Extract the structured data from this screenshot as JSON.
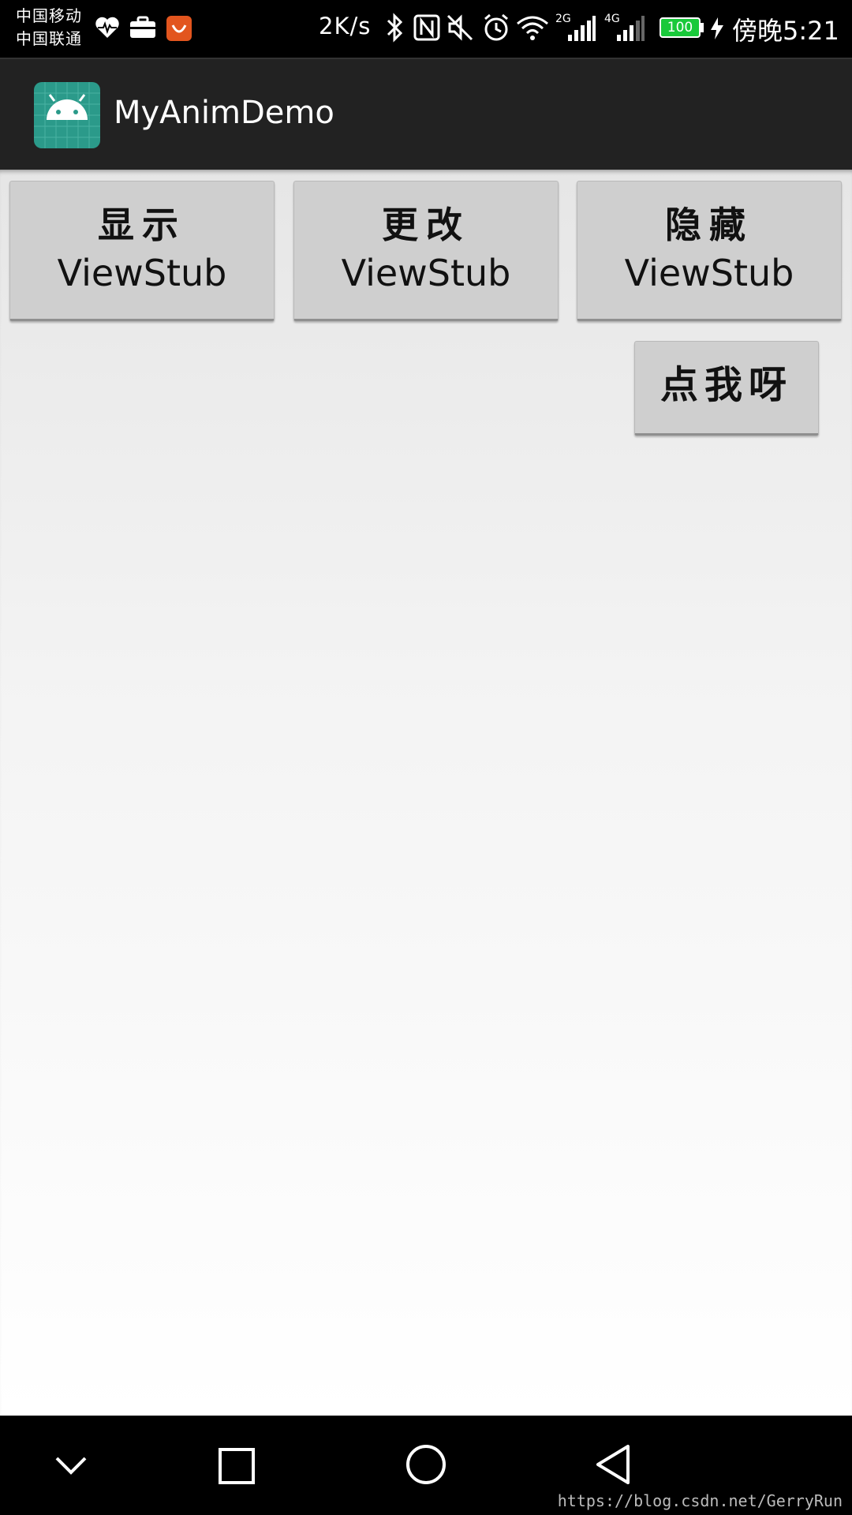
{
  "status_bar": {
    "carrier_1": "中国移动",
    "carrier_2": "中国联通",
    "net_speed": "2K/s",
    "signal_1": "2G",
    "signal_2": "4G",
    "battery": "100",
    "time": "傍晚5:21",
    "icons": [
      "heart-monitor-icon",
      "briefcase-icon",
      "app-notification-icon",
      "bluetooth-icon",
      "nfc-icon",
      "mute-icon",
      "alarm-icon",
      "wifi-icon",
      "signal-icon",
      "charging-icon"
    ],
    "accent_battery": "#19c93a"
  },
  "action_bar": {
    "title": "MyAnimDemo",
    "icon": "android-icon"
  },
  "buttons": {
    "show": {
      "line1": "显示",
      "line2": "ViewStub"
    },
    "change": {
      "line1": "更改",
      "line2": "ViewStub"
    },
    "hide": {
      "line1": "隐藏",
      "line2": "ViewStub"
    },
    "click_me": "点我呀"
  },
  "nav_bar": {
    "icons": [
      "hide-nav-icon",
      "recents-icon",
      "home-icon",
      "back-icon"
    ]
  },
  "watermark": "https://blog.csdn.net/GerryRun"
}
